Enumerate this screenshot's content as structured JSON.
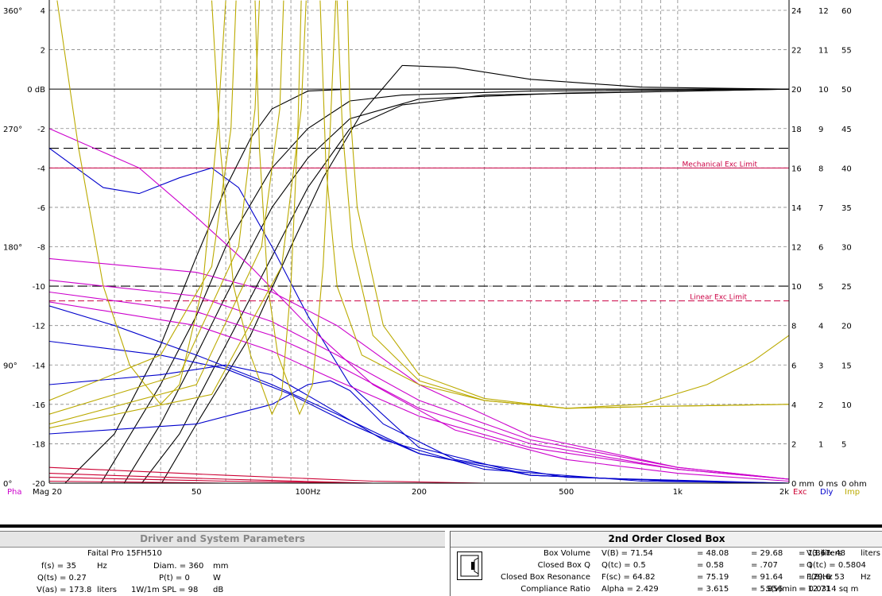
{
  "chart_data": {
    "type": "line",
    "x_scale": "log",
    "x_ticks": [
      "Mag 20",
      "50",
      "100Hz",
      "200",
      "500",
      "1k",
      "2k"
    ],
    "x_tick_values": [
      20,
      50,
      100,
      200,
      500,
      1000,
      2000
    ],
    "xlim": [
      20,
      2000
    ],
    "ylim": [
      -20,
      4
    ],
    "left_mag_ticks": [
      "4",
      "2",
      "0 dB",
      "-2",
      "-4",
      "-6",
      "-8",
      "-10",
      "-12",
      "-14",
      "-16",
      "-18",
      "-20"
    ],
    "left_mag_values": [
      4,
      2,
      0,
      -2,
      -4,
      -6,
      -8,
      -10,
      -12,
      -14,
      -16,
      -18,
      -20
    ],
    "left_phase_ticks": [
      "360°",
      "270°",
      "180°",
      "90°",
      "0°"
    ],
    "left_phase_values": [
      4,
      -2,
      -8,
      -14,
      -20
    ],
    "right_col1_ticks": [
      "24",
      "22",
      "20",
      "18",
      "16",
      "14",
      "12",
      "10",
      "8",
      "6",
      "4",
      "2",
      "0 mm"
    ],
    "right_col2_ticks": [
      "12",
      "11",
      "10",
      "9",
      "8",
      "7",
      "6",
      "5",
      "4",
      "3",
      "2",
      "1",
      "0 ms"
    ],
    "right_col3_ticks": [
      "60",
      "55",
      "50",
      "45",
      "40",
      "35",
      "30",
      "25",
      "20",
      "15",
      "10",
      "5",
      "0 ohm"
    ],
    "right_tick_values": [
      4,
      2,
      0,
      -2,
      -4,
      -6,
      -8,
      -10,
      -12,
      -14,
      -16,
      -18,
      -20
    ],
    "bottom_left_label": "Pha",
    "bottom_right_labels": [
      "Exc",
      "Dly",
      "Imp"
    ],
    "annotations": [
      {
        "text": "Mechanical Exc Limit",
        "y": -4
      },
      {
        "text": "Linear Exc Limit",
        "y": -10.75
      }
    ],
    "reference_lines": [
      {
        "y": -3,
        "style": "dashed",
        "color": "#000000"
      },
      {
        "y": -10,
        "style": "dashed",
        "color": "#000000"
      },
      {
        "y": -4,
        "style": "solid",
        "color": "#cc0044"
      },
      {
        "y": -10.75,
        "style": "dashed",
        "color": "#cc0044"
      }
    ],
    "colors": {
      "magnitude": "#000000",
      "phase": "#cc00cc",
      "excursion": "#cc0033",
      "delay": "#0000cc",
      "impedance": "#bbaa00",
      "grid": "#888888"
    },
    "series": [
      {
        "color": "#000000",
        "points": [
          [
            20,
            -20.8
          ],
          [
            30,
            -17.5
          ],
          [
            40,
            -13
          ],
          [
            50,
            -8.5
          ],
          [
            60,
            -5
          ],
          [
            70,
            -2.5
          ],
          [
            80,
            -1
          ],
          [
            100,
            -0.1
          ],
          [
            130,
            0
          ],
          [
            2000,
            0
          ]
        ]
      },
      {
        "color": "#000000",
        "points": [
          [
            26,
            -20.8
          ],
          [
            40,
            -15
          ],
          [
            50,
            -11.5
          ],
          [
            60,
            -8
          ],
          [
            80,
            -4
          ],
          [
            100,
            -2
          ],
          [
            130,
            -0.6
          ],
          [
            180,
            -0.3
          ],
          [
            400,
            -0.1
          ],
          [
            2000,
            0
          ]
        ]
      },
      {
        "color": "#000000",
        "points": [
          [
            30,
            -20.8
          ],
          [
            40,
            -17
          ],
          [
            50,
            -13.5
          ],
          [
            60,
            -10.5
          ],
          [
            80,
            -6
          ],
          [
            100,
            -3.5
          ],
          [
            130,
            -1.5
          ],
          [
            200,
            -0.5
          ],
          [
            500,
            -0.2
          ],
          [
            2000,
            0
          ]
        ]
      },
      {
        "color": "#000000",
        "points": [
          [
            33,
            -20.8
          ],
          [
            45,
            -17.5
          ],
          [
            60,
            -13
          ],
          [
            80,
            -8.5
          ],
          [
            100,
            -5
          ],
          [
            130,
            -2
          ],
          [
            180,
            -0.8
          ],
          [
            300,
            -0.3
          ],
          [
            2000,
            0
          ]
        ]
      },
      {
        "color": "#000000",
        "points": [
          [
            38,
            -20.8
          ],
          [
            50,
            -17
          ],
          [
            70,
            -12.5
          ],
          [
            90,
            -8
          ],
          [
            110,
            -4.5
          ],
          [
            140,
            -1.2
          ],
          [
            180,
            1.2
          ],
          [
            250,
            1.1
          ],
          [
            400,
            0.5
          ],
          [
            800,
            0.1
          ],
          [
            2000,
            0
          ]
        ]
      },
      {
        "color": "#0000cc",
        "points": [
          [
            20,
            -3
          ],
          [
            28,
            -5
          ],
          [
            35,
            -5.3
          ],
          [
            45,
            -4.5
          ],
          [
            55,
            -4
          ],
          [
            65,
            -5
          ],
          [
            80,
            -8
          ],
          [
            100,
            -11.5
          ],
          [
            130,
            -15
          ],
          [
            200,
            -18.2
          ],
          [
            400,
            -19.6
          ],
          [
            1000,
            -19.9
          ],
          [
            2000,
            -20
          ]
        ]
      },
      {
        "color": "#0000cc",
        "points": [
          [
            20,
            -11
          ],
          [
            30,
            -12
          ],
          [
            50,
            -13.5
          ],
          [
            80,
            -15
          ],
          [
            120,
            -16.5
          ],
          [
            200,
            -18.5
          ],
          [
            400,
            -19.6
          ],
          [
            1000,
            -19.9
          ],
          [
            2000,
            -20
          ]
        ]
      },
      {
        "color": "#0000cc",
        "points": [
          [
            20,
            -12.8
          ],
          [
            40,
            -13.5
          ],
          [
            60,
            -14.2
          ],
          [
            90,
            -15.5
          ],
          [
            130,
            -17
          ],
          [
            200,
            -18.5
          ],
          [
            400,
            -19.6
          ],
          [
            1000,
            -19.9
          ],
          [
            2000,
            -20
          ]
        ]
      },
      {
        "color": "#0000cc",
        "points": [
          [
            20,
            -15
          ],
          [
            40,
            -14.5
          ],
          [
            60,
            -14
          ],
          [
            80,
            -14.5
          ],
          [
            110,
            -16
          ],
          [
            160,
            -17.8
          ],
          [
            300,
            -19.3
          ],
          [
            800,
            -19.9
          ],
          [
            2000,
            -20
          ]
        ]
      },
      {
        "color": "#0000cc",
        "points": [
          [
            20,
            -17.5
          ],
          [
            50,
            -17
          ],
          [
            80,
            -16
          ],
          [
            100,
            -15
          ],
          [
            115,
            -14.8
          ],
          [
            130,
            -15.3
          ],
          [
            160,
            -17
          ],
          [
            250,
            -18.8
          ],
          [
            500,
            -19.7
          ],
          [
            2000,
            -20
          ]
        ]
      },
      {
        "color": "#cc00cc",
        "points": [
          [
            20,
            -2
          ],
          [
            35,
            -4
          ],
          [
            50,
            -6.5
          ],
          [
            70,
            -9
          ],
          [
            100,
            -12
          ],
          [
            150,
            -15
          ],
          [
            250,
            -17.3
          ],
          [
            500,
            -18.8
          ],
          [
            1000,
            -19.5
          ],
          [
            2000,
            -19.9
          ]
        ]
      },
      {
        "color": "#cc00cc",
        "points": [
          [
            20,
            -8.6
          ],
          [
            50,
            -9.3
          ],
          [
            80,
            -10.3
          ],
          [
            120,
            -12
          ],
          [
            200,
            -15
          ],
          [
            400,
            -17.6
          ],
          [
            1000,
            -19.2
          ],
          [
            2000,
            -19.8
          ]
        ]
      },
      {
        "color": "#cc00cc",
        "points": [
          [
            20,
            -9.7
          ],
          [
            50,
            -10.5
          ],
          [
            80,
            -11.8
          ],
          [
            120,
            -13.5
          ],
          [
            200,
            -15.8
          ],
          [
            400,
            -17.8
          ],
          [
            1000,
            -19.2
          ],
          [
            2000,
            -19.8
          ]
        ]
      },
      {
        "color": "#cc00cc",
        "points": [
          [
            20,
            -10.3
          ],
          [
            50,
            -11.3
          ],
          [
            80,
            -12.5
          ],
          [
            120,
            -14
          ],
          [
            200,
            -16.2
          ],
          [
            400,
            -18
          ],
          [
            1000,
            -19.3
          ],
          [
            2000,
            -19.8
          ]
        ]
      },
      {
        "color": "#cc00cc",
        "points": [
          [
            20,
            -10.8
          ],
          [
            50,
            -12
          ],
          [
            80,
            -13.3
          ],
          [
            120,
            -14.8
          ],
          [
            200,
            -16.6
          ],
          [
            400,
            -18.2
          ],
          [
            1000,
            -19.3
          ],
          [
            2000,
            -19.8
          ]
        ]
      },
      {
        "color": "#cc0033",
        "points": [
          [
            20,
            -19.2
          ],
          [
            60,
            -19.6
          ],
          [
            150,
            -19.9
          ],
          [
            300,
            -20
          ],
          [
            2000,
            -20
          ]
        ]
      },
      {
        "color": "#cc0033",
        "points": [
          [
            20,
            -19.5
          ],
          [
            60,
            -19.8
          ],
          [
            150,
            -20
          ],
          [
            2000,
            -20
          ]
        ]
      },
      {
        "color": "#cc0033",
        "points": [
          [
            20,
            -19.7
          ],
          [
            60,
            -19.9
          ],
          [
            150,
            -20
          ],
          [
            2000,
            -20
          ]
        ]
      },
      {
        "color": "#cc0033",
        "points": [
          [
            20,
            -19.9
          ],
          [
            60,
            -20
          ],
          [
            2000,
            -20
          ]
        ]
      },
      {
        "color": "#bbaa00",
        "points": [
          [
            21,
            4.5
          ],
          [
            24,
            -3
          ],
          [
            28,
            -10
          ],
          [
            33,
            -14
          ],
          [
            40,
            -16
          ],
          [
            45,
            -15
          ],
          [
            52,
            -10
          ],
          [
            57,
            -2
          ],
          [
            60,
            4.5
          ]
        ]
      },
      {
        "color": "#bbaa00",
        "points": [
          [
            55,
            4.5
          ],
          [
            58,
            -3
          ],
          [
            63,
            -10
          ],
          [
            70,
            -13.5
          ],
          [
            80,
            -16.5
          ],
          [
            85,
            -15.5
          ],
          [
            90,
            -10
          ],
          [
            94,
            -2
          ],
          [
            96,
            4.5
          ]
        ]
      },
      {
        "color": "#bbaa00",
        "points": [
          [
            72,
            4.5
          ],
          [
            74,
            -3
          ],
          [
            78,
            -10
          ],
          [
            83,
            -13.5
          ],
          [
            95,
            -16.5
          ],
          [
            103,
            -15
          ],
          [
            110,
            -9
          ],
          [
            115,
            -2
          ],
          [
            119,
            4.5
          ]
        ]
      },
      {
        "color": "#bbaa00",
        "points": [
          [
            20,
            -15.8
          ],
          [
            40,
            -13.5
          ],
          [
            55,
            -9
          ],
          [
            62,
            -2
          ],
          [
            64,
            4.5
          ]
        ]
      },
      {
        "color": "#bbaa00",
        "points": [
          [
            20,
            -16.5
          ],
          [
            45,
            -14.5
          ],
          [
            65,
            -8
          ],
          [
            72,
            -1
          ],
          [
            74,
            4.5
          ]
        ]
      },
      {
        "color": "#bbaa00",
        "points": [
          [
            20,
            -17
          ],
          [
            50,
            -15
          ],
          [
            75,
            -8
          ],
          [
            84,
            -1
          ],
          [
            86,
            4.5
          ]
        ]
      },
      {
        "color": "#bbaa00",
        "points": [
          [
            20,
            -17.2
          ],
          [
            55,
            -15.5
          ],
          [
            85,
            -9
          ],
          [
            96,
            -1
          ],
          [
            99,
            4.5
          ]
        ]
      },
      {
        "color": "#bbaa00",
        "points": [
          [
            108,
            4.5
          ],
          [
            112,
            -4
          ],
          [
            120,
            -10
          ],
          [
            140,
            -13.5
          ],
          [
            200,
            -15
          ],
          [
            300,
            -15.8
          ],
          [
            500,
            -16.2
          ],
          [
            800,
            -16
          ],
          [
            1200,
            -15
          ],
          [
            1600,
            -13.8
          ],
          [
            2000,
            -12.5
          ]
        ]
      },
      {
        "color": "#bbaa00",
        "points": [
          [
            120,
            4.5
          ],
          [
            124,
            -2
          ],
          [
            132,
            -8
          ],
          [
            150,
            -12.5
          ],
          [
            200,
            -14.8
          ],
          [
            300,
            -15.8
          ],
          [
            500,
            -16.2
          ],
          [
            900,
            -16.1
          ],
          [
            2000,
            -16
          ]
        ]
      },
      {
        "color": "#bbaa00",
        "points": [
          [
            128,
            4.5
          ],
          [
            130,
            -1
          ],
          [
            136,
            -6
          ],
          [
            160,
            -12
          ],
          [
            200,
            -14.5
          ],
          [
            300,
            -15.7
          ],
          [
            500,
            -16.2
          ],
          [
            900,
            -16.1
          ],
          [
            2000,
            -16
          ]
        ]
      }
    ]
  },
  "driver_panel": {
    "title": "Driver and System Parameters",
    "model": "Faital Pro  15FH510",
    "fs_label": "f(s) = 35",
    "fs_unit": "Hz",
    "diam_label": "Diam. = 360",
    "diam_unit": "mm",
    "qts_label": "Q(ts) = 0.27",
    "pt_label": "P(t) = 0",
    "pt_unit": "W",
    "vas_label": "V(as) = 173.8",
    "vas_unit": "liters",
    "spl_label": "1W/1m SPL = 98",
    "spl_unit": "dB"
  },
  "box_panel": {
    "title": "2nd Order Closed Box",
    "rows": [
      {
        "label": "Box Volume",
        "cells": [
          "V(B) = 71.54",
          "= 48.08",
          "= 29.68",
          "= 13.67",
          "liters"
        ],
        "side": "V(B) = 48",
        "side_unit": "liters"
      },
      {
        "label": "Closed Box Q",
        "cells": [
          "Q(tc) = 0.5",
          "= 0.58",
          "= .707",
          "= 1",
          ""
        ],
        "side": "Q(tc) = 0.5804",
        "side_unit": ""
      },
      {
        "label": "Closed Box Resonance",
        "cells": [
          "F(sc) = 64.82",
          "= 75.19",
          "= 91.64",
          "= 129.6",
          "Hz"
        ],
        "side": "F(B) = 53",
        "side_unit": "Hz"
      },
      {
        "label": "Compliance Ratio",
        "cells": [
          "Alpha = 2.429",
          "= 3.615",
          "= 5.856",
          "= 12.71",
          ""
        ],
        "side": "S(v)min = 0.0314 sq m",
        "side_unit": ""
      }
    ]
  }
}
